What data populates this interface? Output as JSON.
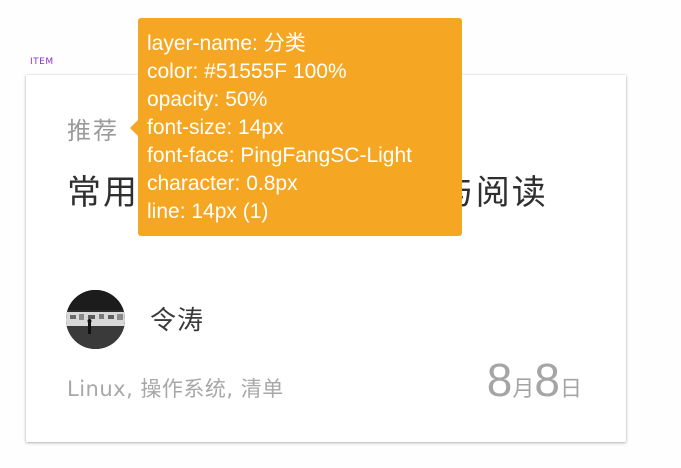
{
  "artboard": {
    "label": "ITEM"
  },
  "card": {
    "category": "推荐",
    "title": "常用软件（一）— 办公与阅读",
    "author": "令涛",
    "tags": "Linux, 操作系统, 清单",
    "date": {
      "month": "8",
      "month_unit": "月",
      "day": "8",
      "day_unit": "日"
    }
  },
  "inspector": {
    "lines": [
      "layer-name: 分类",
      "color: #51555F 100%",
      "opacity: 50%",
      "font-size: 14px",
      "font-face: PingFangSC-Light",
      "character: 0.8px",
      "line: 14px (1)"
    ],
    "background": "#F5A623"
  }
}
